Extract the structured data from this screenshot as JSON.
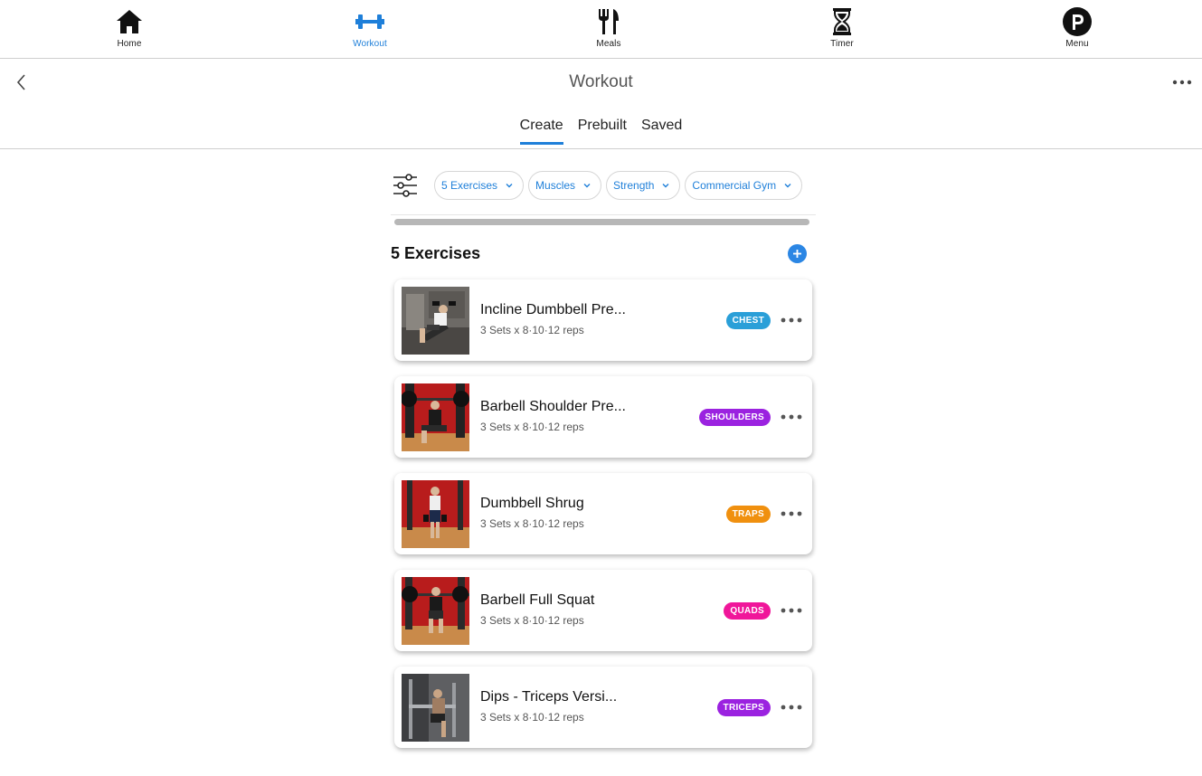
{
  "nav": [
    {
      "label": "Home",
      "icon": "home-icon"
    },
    {
      "label": "Workout",
      "icon": "dumbbell-icon",
      "active": true
    },
    {
      "label": "Meals",
      "icon": "fork-knife-icon"
    },
    {
      "label": "Timer",
      "icon": "hourglass-icon"
    },
    {
      "label": "Menu",
      "icon": "profile-p-icon"
    }
  ],
  "header": {
    "title": "Workout",
    "tabs": [
      {
        "label": "Create",
        "active": true
      },
      {
        "label": "Prebuilt"
      },
      {
        "label": "Saved"
      }
    ]
  },
  "filters": [
    {
      "label": "5 Exercises"
    },
    {
      "label": "Muscles"
    },
    {
      "label": "Strength"
    },
    {
      "label": "Commercial Gym"
    }
  ],
  "section": {
    "title": "5 Exercises"
  },
  "exercises": [
    {
      "name": "Incline Dumbbell Pre...",
      "sets": "3 Sets x 8·10·12 reps",
      "muscle": "CHEST",
      "color": "#2a9fd8"
    },
    {
      "name": "Barbell Shoulder Pre...",
      "sets": "3 Sets x 8·10·12 reps",
      "muscle": "SHOULDERS",
      "color": "#9b22e0"
    },
    {
      "name": "Dumbbell Shrug",
      "sets": "3 Sets x 8·10·12 reps",
      "muscle": "TRAPS",
      "color": "#f0900f"
    },
    {
      "name": "Barbell Full Squat",
      "sets": "3 Sets x 8·10·12 reps",
      "muscle": "QUADS",
      "color": "#f0169a"
    },
    {
      "name": "Dips - Triceps Versi...",
      "sets": "3 Sets x 8·10·12 reps",
      "muscle": "TRICEPS",
      "color": "#9b22e0"
    }
  ],
  "colors": {
    "accent": "#1e7fd9",
    "add_button": "#2b86e4"
  }
}
